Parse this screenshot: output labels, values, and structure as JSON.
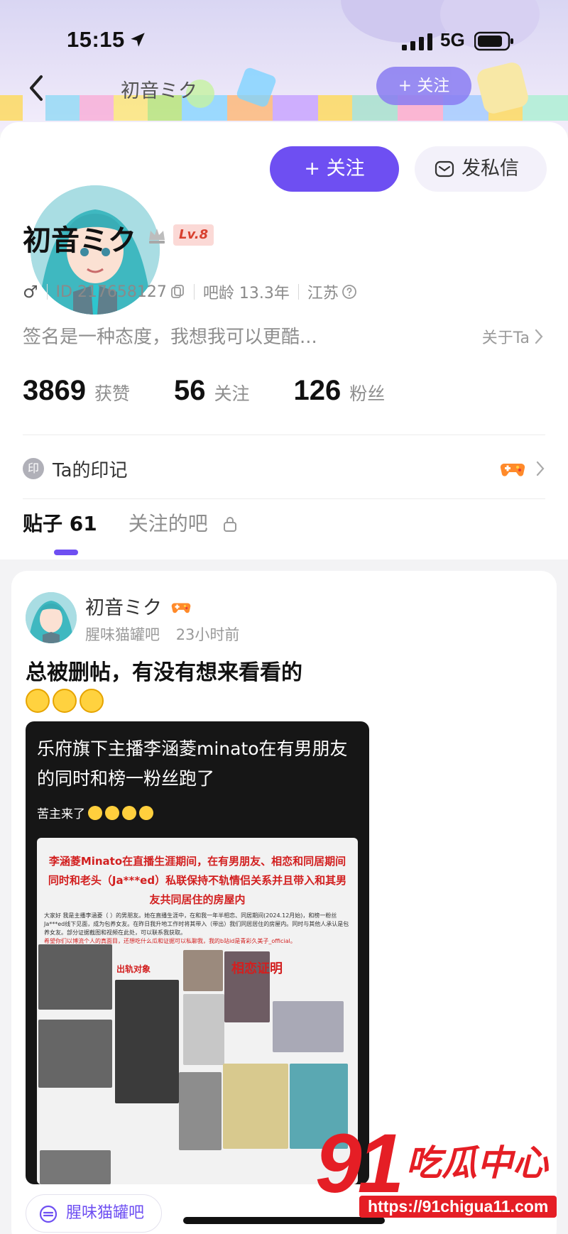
{
  "status_bar": {
    "time": "15:15",
    "network": "5G"
  },
  "nav": {
    "title": "初音ミク",
    "follow_label": "+ 关注"
  },
  "profile": {
    "follow_label": "+ 关注",
    "message_label": "发私信",
    "name": "初音ミク",
    "level": "Lv.8",
    "gender_symbol": "♂",
    "id_text": "ID 217658127",
    "age_text": "吧龄 13.3年",
    "location": "江苏",
    "signature": "签名是一种态度，我想我可以更酷...",
    "about_label": "关于Ta",
    "stats": [
      {
        "value": "3869",
        "label": "获赞"
      },
      {
        "value": "56",
        "label": "关注"
      },
      {
        "value": "126",
        "label": "粉丝"
      }
    ],
    "imprint_icon_text": "印",
    "imprint_label": "Ta的印记"
  },
  "tabs": [
    {
      "label": "贴子 61"
    },
    {
      "label": "关注的吧"
    }
  ],
  "post": {
    "author": "初音ミク",
    "forum": "腥味猫罐吧",
    "time_ago": "23小时前",
    "title": "总被删帖，有没有想来看看的",
    "image": {
      "headline": "乐府旗下主播李涵菱minato在有男朋友的同时和榜一粉丝跑了",
      "sub": "苦主来了",
      "paper_head_1": "李涵菱Minato在直播生涯期间，在有男朋友、相恋和同居期间同时和老头（Ja***ed）私联保持不轨情侣关系并且带入和其男友共同居住的房屋内",
      "paper_body_1": "大家好 我是主播李涵菱（  ）的男朋友。她在直播生涯中，在和我一年半相恋、同居期间(2024.12月始)，和榜一粉丝Ja***ed线下见面，成为包养女友。在昨日我升地工作时将其带入（带出）我们同居居住的房屋内。同时与其他人承认是包养女友。部分证据截图和视频在此处，可以联系我获取。",
      "paper_body_2": "希望你们以博流个人的真面目，还想吃什么瓜和证据可以私聊我，我的b站id是青彩久美子_official。",
      "label_1": "出轨对象",
      "label_2": "相恋证明"
    },
    "tag_label": "腥味猫罐吧"
  },
  "watermark": {
    "number": "91",
    "brand": "吃瓜中心",
    "url": "https://91chigua11.com"
  },
  "colors": {
    "accent": "#6e4ff2",
    "level_badge": "#d8402f",
    "watermark": "#e51e25"
  }
}
